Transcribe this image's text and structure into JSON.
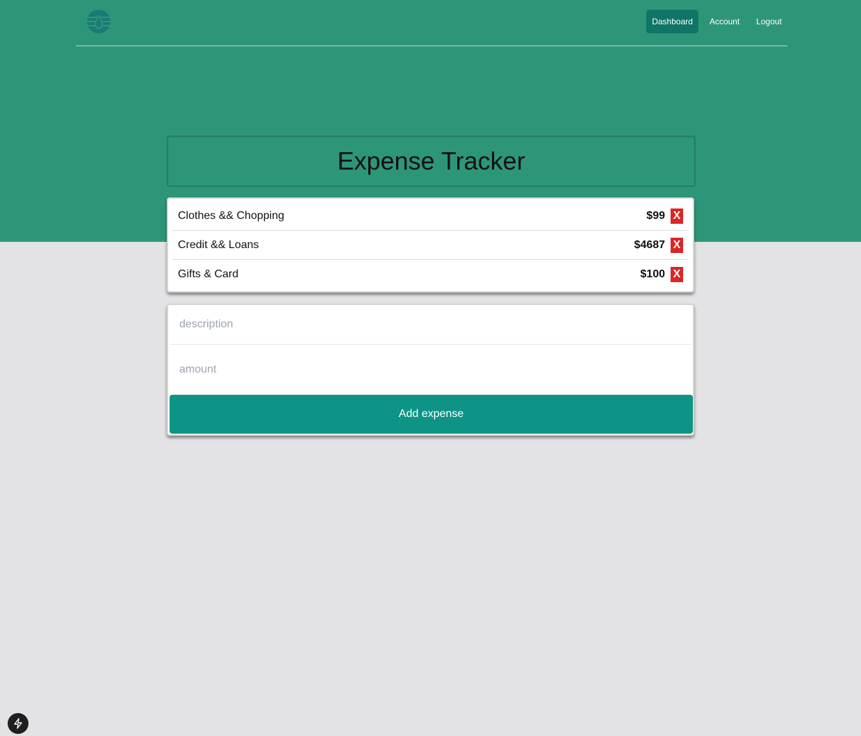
{
  "colors": {
    "hero_bg": "#2e9678",
    "nav_active_bg": "#107566",
    "delete_bg": "#dc2626",
    "button_bg": "#0e9486",
    "page_bg": "#e3e3e5"
  },
  "nav": {
    "logo_icon": "water-drop-globe-icon",
    "links": [
      {
        "label": "Dashboard",
        "active": true
      },
      {
        "label": "Account",
        "active": false
      },
      {
        "label": "Logout",
        "active": false
      }
    ]
  },
  "main": {
    "title": "Expense Tracker",
    "expenses": [
      {
        "description": "Clothes && Chopping",
        "amount": "$99",
        "delete_label": "X"
      },
      {
        "description": "Credit && Loans",
        "amount": "$4687",
        "delete_label": "X"
      },
      {
        "description": "Gifts & Card",
        "amount": "$100",
        "delete_label": "X"
      }
    ],
    "form": {
      "description_placeholder": "description",
      "amount_placeholder": "amount",
      "submit_label": "Add expense"
    }
  },
  "dev_badge_icon": "lightning-icon"
}
